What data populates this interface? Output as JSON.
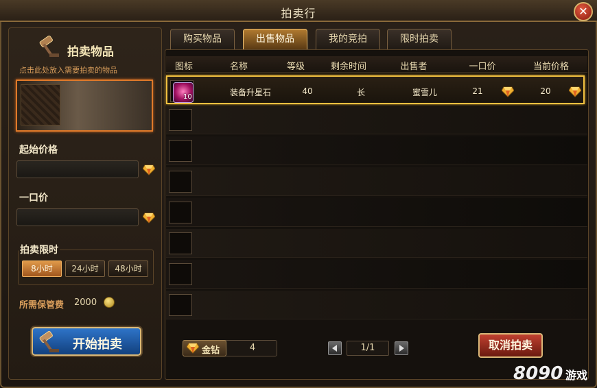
{
  "window": {
    "title": "拍卖行",
    "close_symbol": "✕"
  },
  "left": {
    "header_title": "拍卖物品",
    "hint": "点击此处放入需要拍卖的物品",
    "start_price_label": "起始价格",
    "start_price_value": "",
    "buyout_label": "一口价",
    "buyout_value": "",
    "time_limit_label": "拍卖限时",
    "time_options": [
      "8小时",
      "24小时",
      "48小时"
    ],
    "time_selected": "8小时",
    "fee_label": "所需保管费",
    "fee_value": "2000",
    "start_button": "开始拍卖"
  },
  "tabs": [
    {
      "label": "购买物品",
      "active": false
    },
    {
      "label": "出售物品",
      "active": true
    },
    {
      "label": "我的竞拍",
      "active": false
    },
    {
      "label": "限时拍卖",
      "active": false
    }
  ],
  "table": {
    "headers": [
      "图标",
      "名称",
      "等级",
      "剩余时间",
      "出售者",
      "一口价",
      "当前价格"
    ],
    "rows": [
      {
        "icon": "star-gem-icon",
        "quantity": "10",
        "name": "装备升星石",
        "level": "40",
        "time_left": "长",
        "seller": "蜜雪儿",
        "buyout": "21",
        "current": "20"
      }
    ]
  },
  "footer": {
    "currency_label": "金钻",
    "currency_value": "4",
    "page": "1/1",
    "cancel_button": "取消拍卖"
  },
  "watermark": {
    "number": "8090",
    "text": "游戏"
  },
  "colors": {
    "accent": "#f0c040",
    "tab_active": "#b07a30",
    "start_btn": "#2e74c8",
    "cancel_btn": "#c04030"
  }
}
